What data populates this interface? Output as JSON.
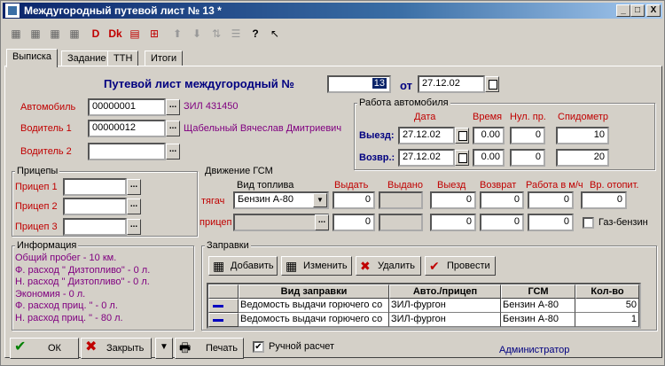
{
  "window": {
    "title": "Междугородный путевой лист №    13 *",
    "controls": [
      "_",
      "□",
      "X"
    ]
  },
  "tabs": [
    {
      "label": "Выписка"
    },
    {
      "label": "Задание"
    },
    {
      "label": "ТТН"
    },
    {
      "label": "Итоги"
    }
  ],
  "header": {
    "title": "Путевой лист междугородный №",
    "number": "13",
    "from_label": "от",
    "date": "27.12.02"
  },
  "vehicle": {
    "car_label": "Автомобиль",
    "car_code": "00000001",
    "car_name": "ЗИЛ 431450",
    "driver1_label": "Водитель 1",
    "driver1_code": "00000012",
    "driver1_name": "Щабельный Вячеслав Дмитриевич",
    "driver2_label": "Водитель 2",
    "driver2_code": ""
  },
  "work": {
    "title": "Работа автомобиля",
    "col_date": "Дата",
    "col_time": "Время",
    "col_zero": "Нул. пр.",
    "col_speedo": "Спидометр",
    "departure_label": "Выезд:",
    "departure_date": "27.12.02",
    "departure_time": "0.00",
    "departure_zero": "0",
    "departure_speedo": "10",
    "return_label": "Возвр.:",
    "return_date": "27.12.02",
    "return_time": "0.00",
    "return_zero": "0",
    "return_speedo": "20"
  },
  "trailers": {
    "title": "Прицепы",
    "trailer1_label": "Прицеп 1",
    "trailer2_label": "Прицеп 2",
    "trailer3_label": "Прицеп 3"
  },
  "fuel": {
    "title": "Движение ГСМ",
    "col_type": "Вид топлива",
    "col_issue": "Выдать",
    "col_issued": "Выдано",
    "col_depart": "Выезд",
    "col_return": "Возврат",
    "col_work": "Работа в м/ч",
    "col_heat": "Вр. отопит.",
    "tractor_label": "тягач",
    "tractor_fuel": "Бензин А-80",
    "tractor_issue": "0",
    "tractor_issued": "",
    "tractor_depart": "0",
    "tractor_return": "0",
    "tractor_work": "0",
    "tractor_heat": "0",
    "trailer_label": "прицеп",
    "trailer_fuel": "",
    "trailer_issue": "0",
    "trailer_issued": "",
    "trailer_depart": "0",
    "trailer_return": "0",
    "trailer_work": "0",
    "gas_label": "Газ-бензин"
  },
  "info": {
    "title": "Информация",
    "lines": [
      "Общий пробег - 10 км.",
      "Ф. расход \" Дизтопливо\" - 0 л.",
      "Н. расход \" Дизтопливо\" - 0 л.",
      "Экономия - 0 л.",
      "Ф. расход приц. \"  - 0 л.",
      "Н. расход приц. \"  - 80 л."
    ]
  },
  "refuel": {
    "title": "Заправки",
    "add": "Добавить",
    "edit": "Изменить",
    "delete": "Удалить",
    "post": "Провести",
    "headers": [
      "Вид заправки",
      "Авто./прицеп",
      "ГСМ",
      "Кол-во"
    ],
    "rows": [
      {
        "kind": "Ведомость выдачи горючего со",
        "vehicle": "ЗИЛ-фургон",
        "fuel": "Бензин А-80",
        "qty": "50"
      },
      {
        "kind": "Ведомость выдачи горючего со",
        "vehicle": "ЗИЛ-фургон",
        "fuel": "Бензин А-80",
        "qty": "1"
      }
    ]
  },
  "footer": {
    "ok": "ОК",
    "close": "Закрыть",
    "print": "Печать",
    "manual_calc": "Ручной расчет",
    "manual_checked": "✔",
    "user": "Администратор"
  }
}
